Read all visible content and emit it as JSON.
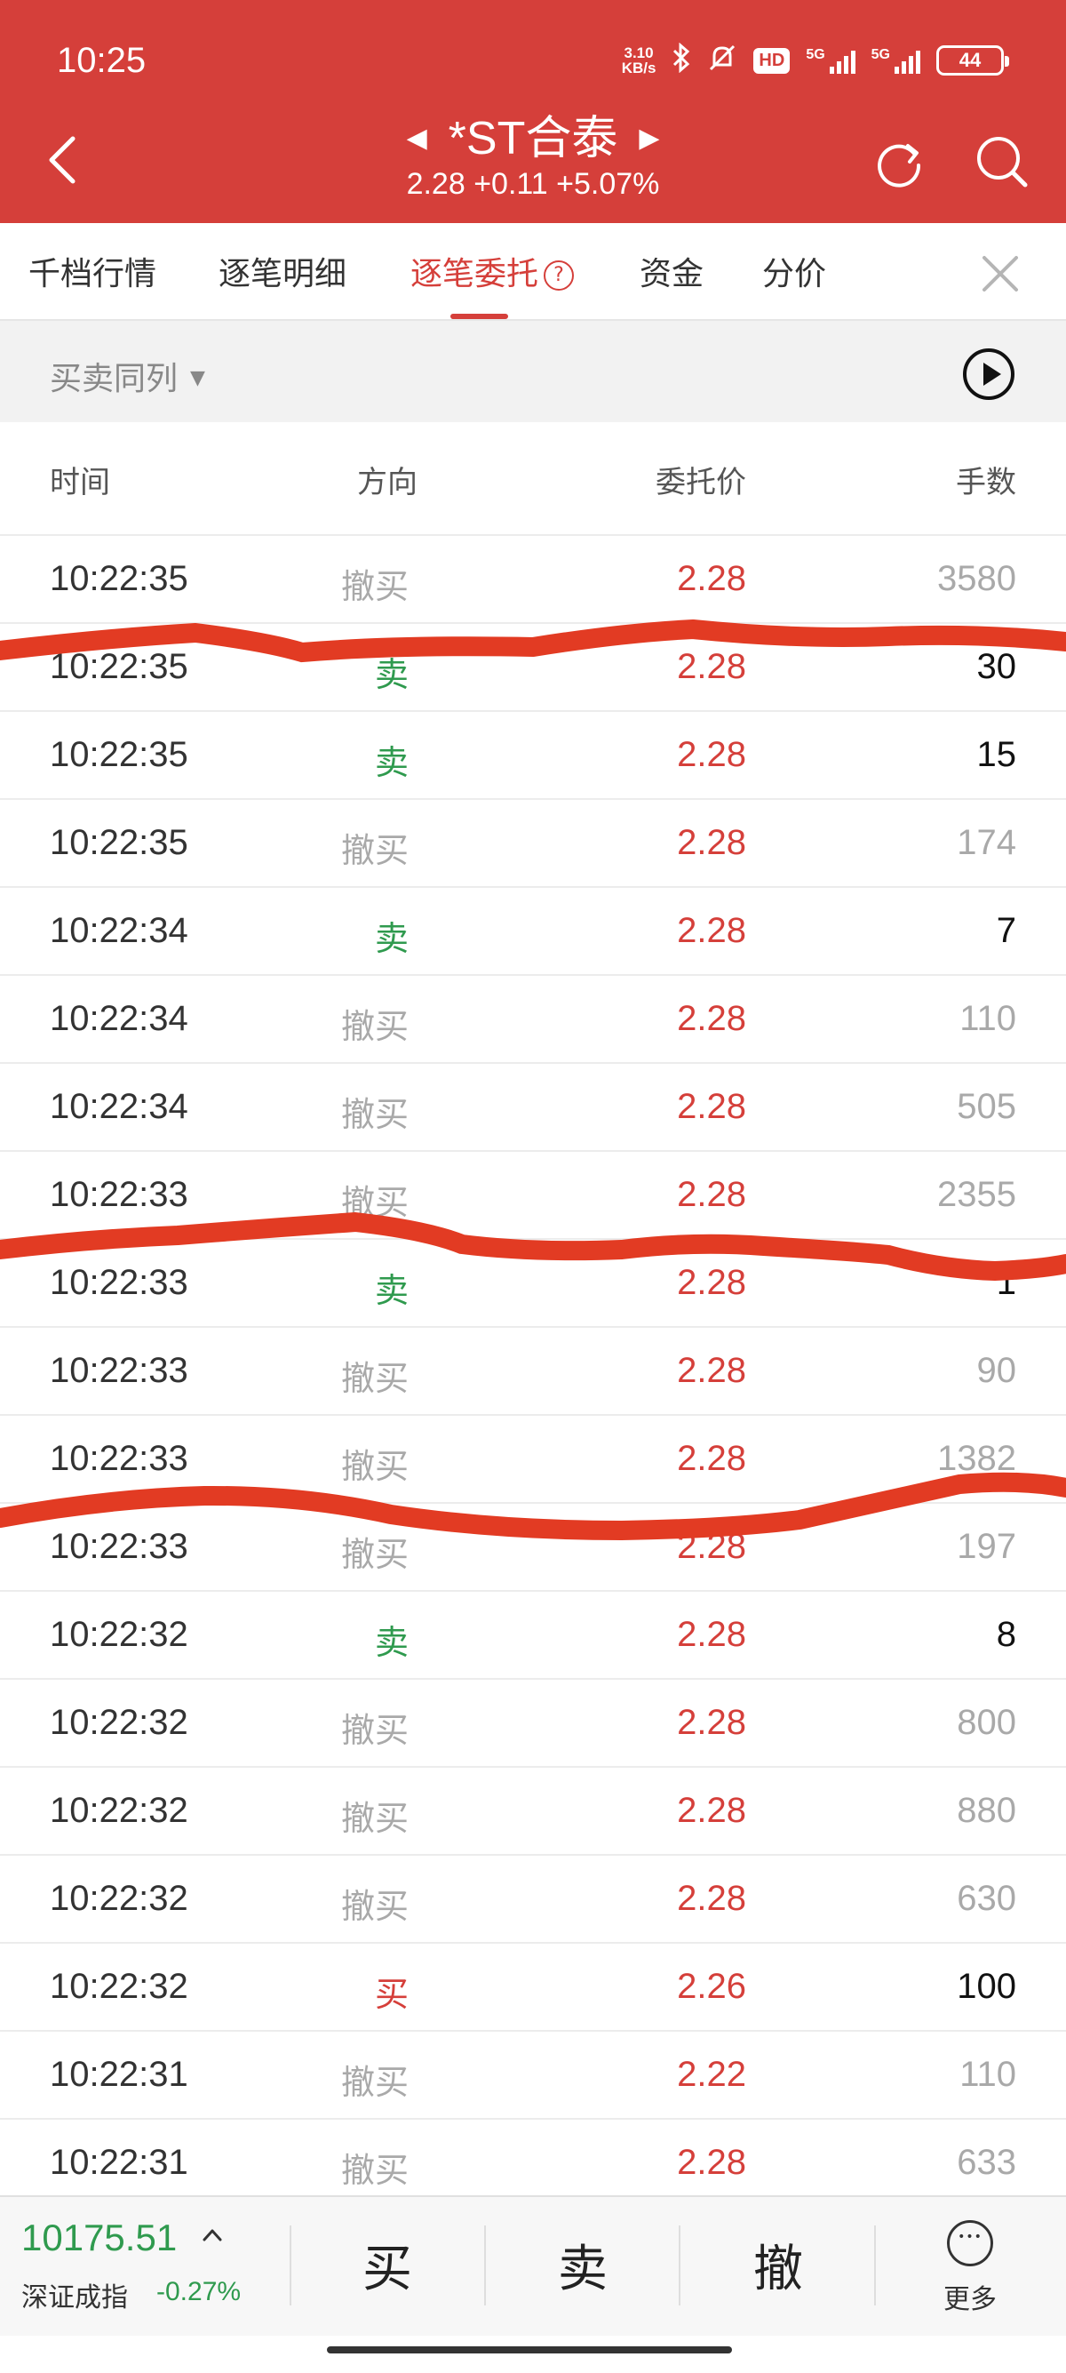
{
  "status_bar": {
    "time": "10:25",
    "net_speed_top": "3.10",
    "net_speed_bottom": "KB/s",
    "sim1_label": "5G",
    "sim2_label": "5G",
    "battery": "44",
    "hd_label": "HD"
  },
  "header": {
    "stock_name": "*ST合泰",
    "quote": "2.28 +0.11 +5.07%",
    "color": "#d53f3a"
  },
  "tabs": [
    {
      "label": "千档行情",
      "active": false
    },
    {
      "label": "逐笔明细",
      "active": false
    },
    {
      "label": "逐笔委托",
      "active": true
    },
    {
      "label": "资金",
      "active": false
    },
    {
      "label": "分价",
      "active": false
    }
  ],
  "filter": {
    "label": "买卖同列"
  },
  "columns": {
    "time": "时间",
    "direction": "方向",
    "price": "委托价",
    "quantity": "手数"
  },
  "rows": [
    {
      "time": "10:22:35",
      "dir": "撤买",
      "price": "2.28",
      "qty": "3580",
      "kind": "cancel"
    },
    {
      "time": "10:22:35",
      "dir": "卖",
      "price": "2.28",
      "qty": "30",
      "kind": "sell"
    },
    {
      "time": "10:22:35",
      "dir": "卖",
      "price": "2.28",
      "qty": "15",
      "kind": "sell"
    },
    {
      "time": "10:22:35",
      "dir": "撤买",
      "price": "2.28",
      "qty": "174",
      "kind": "cancel"
    },
    {
      "time": "10:22:34",
      "dir": "卖",
      "price": "2.28",
      "qty": "7",
      "kind": "sell"
    },
    {
      "time": "10:22:34",
      "dir": "撤买",
      "price": "2.28",
      "qty": "110",
      "kind": "cancel"
    },
    {
      "time": "10:22:34",
      "dir": "撤买",
      "price": "2.28",
      "qty": "505",
      "kind": "cancel"
    },
    {
      "time": "10:22:33",
      "dir": "撤买",
      "price": "2.28",
      "qty": "2355",
      "kind": "cancel"
    },
    {
      "time": "10:22:33",
      "dir": "卖",
      "price": "2.28",
      "qty": "1",
      "kind": "sell"
    },
    {
      "time": "10:22:33",
      "dir": "撤买",
      "price": "2.28",
      "qty": "90",
      "kind": "cancel"
    },
    {
      "time": "10:22:33",
      "dir": "撤买",
      "price": "2.28",
      "qty": "1382",
      "kind": "cancel"
    },
    {
      "time": "10:22:33",
      "dir": "撤买",
      "price": "2.28",
      "qty": "197",
      "kind": "cancel"
    },
    {
      "time": "10:22:32",
      "dir": "卖",
      "price": "2.28",
      "qty": "8",
      "kind": "sell"
    },
    {
      "time": "10:22:32",
      "dir": "撤买",
      "price": "2.28",
      "qty": "800",
      "kind": "cancel"
    },
    {
      "time": "10:22:32",
      "dir": "撤买",
      "price": "2.28",
      "qty": "880",
      "kind": "cancel"
    },
    {
      "time": "10:22:32",
      "dir": "撤买",
      "price": "2.28",
      "qty": "630",
      "kind": "cancel"
    },
    {
      "time": "10:22:32",
      "dir": "买",
      "price": "2.26",
      "qty": "100",
      "kind": "buy"
    },
    {
      "time": "10:22:31",
      "dir": "撤买",
      "price": "2.22",
      "qty": "110",
      "kind": "cancel"
    },
    {
      "time": "10:22:31",
      "dir": "撤买",
      "price": "2.28",
      "qty": "633",
      "kind": "cancel"
    }
  ],
  "bottom": {
    "index_value": "10175.51",
    "index_name": "深证成指",
    "index_change": "-0.27%",
    "buy_label": "买",
    "sell_label": "卖",
    "cancel_label": "撤",
    "more_label": "更多"
  },
  "colors": {
    "up": "#d53f3a",
    "down": "#2f9a4e",
    "muted": "#a9a9a9"
  }
}
